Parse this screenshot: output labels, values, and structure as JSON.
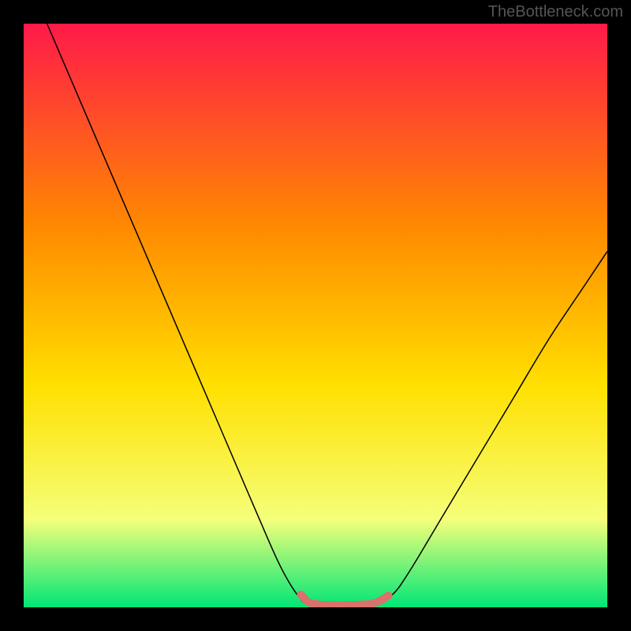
{
  "attribution": "TheBottleneck.com",
  "chart_data": {
    "type": "line",
    "title": "",
    "xlabel": "",
    "ylabel": "",
    "xlim": [
      0,
      100
    ],
    "ylim": [
      0,
      100
    ],
    "background_gradient": {
      "top": "#ff1a4a",
      "mid1": "#ff8a00",
      "mid2": "#ffe000",
      "mid3": "#f5ff7a",
      "bottom": "#00e676"
    },
    "series": [
      {
        "name": "bottleneck-curve",
        "color": "#000000",
        "stroke_width": 1.5,
        "points": [
          {
            "x": 4,
            "y": 100
          },
          {
            "x": 10,
            "y": 86
          },
          {
            "x": 16,
            "y": 72
          },
          {
            "x": 22,
            "y": 58
          },
          {
            "x": 28,
            "y": 44
          },
          {
            "x": 34,
            "y": 30
          },
          {
            "x": 40,
            "y": 16
          },
          {
            "x": 44,
            "y": 7
          },
          {
            "x": 47,
            "y": 2
          },
          {
            "x": 49,
            "y": 0.5
          },
          {
            "x": 55,
            "y": 0.3
          },
          {
            "x": 60,
            "y": 0.5
          },
          {
            "x": 63,
            "y": 2
          },
          {
            "x": 66,
            "y": 6
          },
          {
            "x": 72,
            "y": 16
          },
          {
            "x": 78,
            "y": 26
          },
          {
            "x": 84,
            "y": 36
          },
          {
            "x": 90,
            "y": 46
          },
          {
            "x": 96,
            "y": 55
          },
          {
            "x": 100,
            "y": 61
          }
        ]
      },
      {
        "name": "optimal-zone",
        "color": "#d9716c",
        "stroke_width": 10,
        "linecap": "round",
        "points": [
          {
            "x": 47.5,
            "y": 2.2
          },
          {
            "x": 49,
            "y": 0.8
          },
          {
            "x": 52,
            "y": 0.4
          },
          {
            "x": 56,
            "y": 0.4
          },
          {
            "x": 60,
            "y": 0.7
          },
          {
            "x": 62.5,
            "y": 2.0
          }
        ]
      }
    ]
  }
}
